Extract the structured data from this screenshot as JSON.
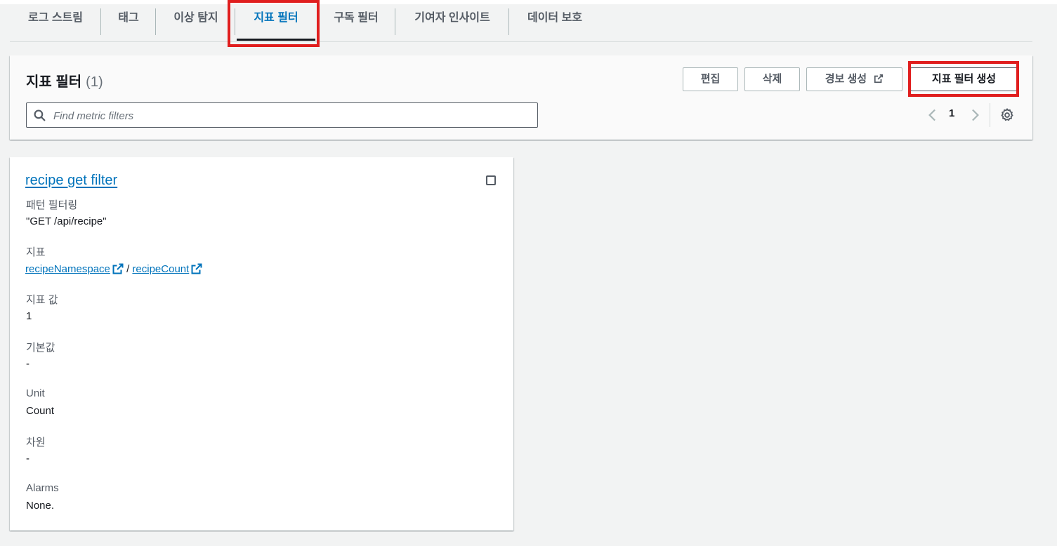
{
  "tabs": [
    {
      "label": "로그 스트림",
      "active": false
    },
    {
      "label": "태그",
      "active": false
    },
    {
      "label": "이상 탐지",
      "active": false
    },
    {
      "label": "지표 필터",
      "active": true
    },
    {
      "label": "구독 필터",
      "active": false
    },
    {
      "label": "기여자 인사이트",
      "active": false
    },
    {
      "label": "데이터 보호",
      "active": false
    }
  ],
  "header": {
    "title": "지표 필터",
    "count": "(1)",
    "buttons": {
      "edit": "편집",
      "delete": "삭제",
      "create_alarm": "경보 생성",
      "create_metric_filter": "지표 필터 생성"
    },
    "search_placeholder": "Find metric filters",
    "pagination": {
      "current_page": "1"
    }
  },
  "filter_card": {
    "name": "recipe get filter",
    "pattern_label": "패턴 필터링",
    "pattern_value": "\"GET /api/recipe\"",
    "metric_label": "지표",
    "metric_namespace": "recipeNamespace",
    "metric_separator": " / ",
    "metric_name": "recipeCount",
    "metric_value_label": "지표 값",
    "metric_value": "1",
    "default_value_label": "기본값",
    "default_value": "-",
    "unit_label": "Unit",
    "unit_value": "Count",
    "dimensions_label": "차원",
    "dimensions_value": "-",
    "alarms_label": "Alarms",
    "alarms_value": "None."
  },
  "colors": {
    "link": "#0073bb",
    "highlight": "#e01e1e",
    "background": "#f2f3f3"
  }
}
